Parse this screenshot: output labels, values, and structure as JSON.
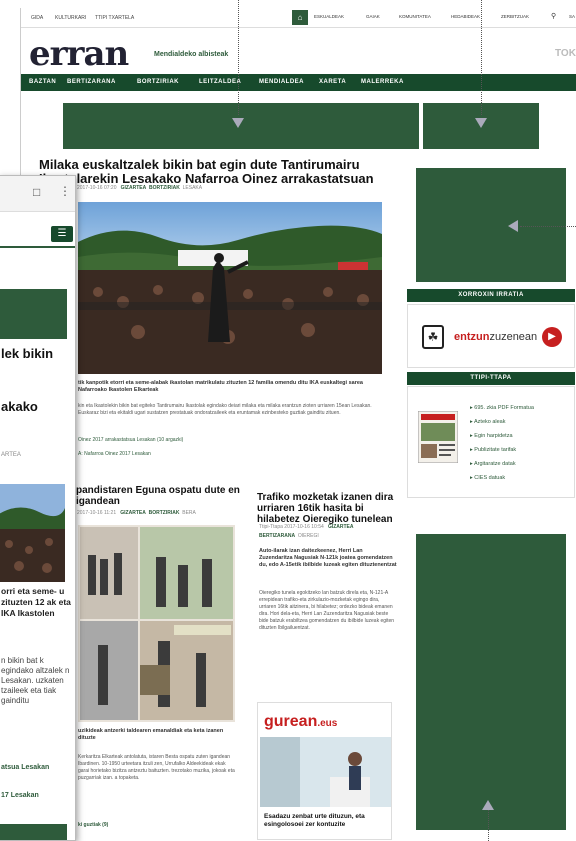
{
  "topbar": {
    "links": [
      "GIDA",
      "KULTURKARI",
      "TTIPI TXARTELA"
    ],
    "tabs": [
      "ESKUALDEAK",
      "GAIAK",
      "KOMUNITATEA",
      "HEDABIDEAK",
      "ZERBITZUAK"
    ],
    "search_icon": "search-icon",
    "extra": "SA"
  },
  "brand": {
    "logo": "erran",
    "tagline": "Mendialdeko albisteak",
    "partial": "TOKIN"
  },
  "nav": [
    "BAZTAN",
    "BERTIZARANA",
    "BORTZIRIAK",
    "LEITZALDEA",
    "MENDIALDEA",
    "XARETA",
    "MALERREKA"
  ],
  "colors": {
    "accent": "#174a2c",
    "ad_green": "#2e5b3b"
  },
  "main_article": {
    "title_line1": "Milaka euskaltzalek bikin bat egin dute Tantirumairu",
    "title_line2": "Ikastolarekin Lesakako Nafarroa Oinez arrakastatsuan",
    "date": "2017-10-16 07:20",
    "tags": [
      "GIZARTEA",
      "BORTZIRIAK",
      "LESAKA"
    ],
    "caption": "tik kanpotik etorri eta seme-alabak ikastolan matrikulatu zituzten 12 familia omendu ditu IKA euskaltegi sarea Nafarroako Ikastolen Elkarteak",
    "para": "kin eta Ikastolekin bikin bat egiteko Tantirumairu Ikastolak egindako deiari milaka eta milaka erantzun zioten urriaren 15ean Lesakan. Euskaraz bizi eta ekitaldi ugari sustatzen prestatuak ondoratzaileek eta eruntamak ezinbesteko guztiak gainditu zituen.",
    "link1": "Oinez 2017 arrakastatsua Lesakan (10 argazki)",
    "link2": "A: Nafarroa Oinez 2017 Lesakan"
  },
  "second_article": {
    "title": "pandistaren Eguna ospatu dute en igandean",
    "date": "2017-10-16 11:21",
    "tags": [
      "GIZARTEA",
      "BORTZIRIAK",
      "BERA"
    ],
    "caption": "uzikideak antzerki taldearen emanaldiak eta keta izanen dituzte",
    "para": "Kerkaritza Elkarteak antolatuta, istaren Besta ospatu zuten igandean Ibardinen. 10-1950 urteetara itzuli zen, Urrufalko Aldeekideak ekak garai horietako bizitza antzeztu baituzten. trezotako muzika, jokoak eta puzgarriak izan. a topaketa.",
    "link": "ki guztiak (9)"
  },
  "traffic_article": {
    "title": "Trafiko mozketak izanen dira urriaren 16tik hasita bi hilabetez Oieregiko tunelean",
    "date": "Ttipi-Ttapa 2017-10-16 10:54",
    "tags": [
      "GIZARTEA",
      "BERTIZARANA",
      "OIEREGI"
    ],
    "lede": "Auto-ilarak izan daitezkeenez, Herri Lan Zuzendaritza Nagusiak N-121k joatea gomendatzen du, edo A-15etik ibilbide luzeak egiten dituztenentzat",
    "para": "Oieregiko tunela egokitzeko lan batzuk direla eta, N-121-A errepidean trafiko-eta zirkulazio-mozketak egingo dira, urriaren 16tik aitzinera, bi hilabetez; ordezko bideak emanen dira. Hori dela-eta, Herri Lan Zuzendaritza Nagusiak beste bide batzuk erabiltzea gomendatzen du ibilbide luzeak egiten dituzten Ibilgailuentzat."
  },
  "gurean": {
    "logo": "gurean",
    "suffix": ".eus",
    "text": "Esadazu zenbat urte dituzun, eta esingolosoei zer kontuzite"
  },
  "xorroxin": {
    "title": "XORROXIN IRRATIA",
    "logo_red": "entzun",
    "logo_dark": "zuzenean"
  },
  "ttipi": {
    "title": "TTIPI-TTAPA",
    "links": [
      "695. zkia PDF Formatua",
      "Azteko aleak",
      "Egin harpidetza",
      "Publizitate tarifak",
      "Argitaratze datak",
      "CIES datuak"
    ]
  },
  "mobile": {
    "h1": "lek bikin",
    "h2": "akako",
    "tag": "ARTEA",
    "lead": "orri eta seme- u zituzten 12 ak eta IKA Ikastolen",
    "para": "n bikin bat k egindako altzalek n Lesakan. uzkaten tzaileek eta tiak gainditu",
    "link1": "atsua Lesakan",
    "link2": "17 Lesakan"
  }
}
